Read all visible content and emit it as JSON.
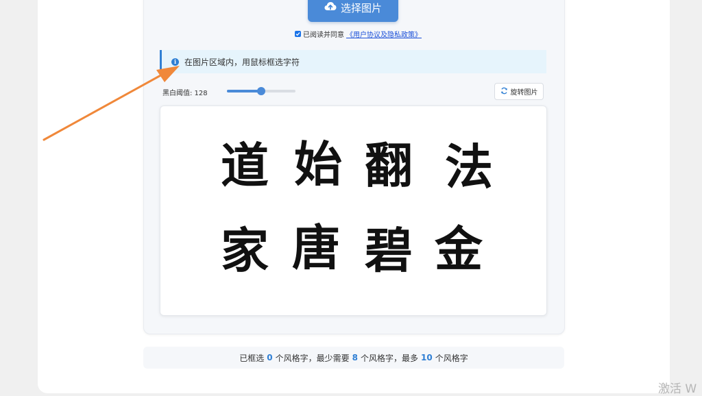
{
  "upload": {
    "choose_label": "选择图片",
    "agree_text": "已阅读并同意",
    "policy_link": "《用户协议及隐私政策》",
    "agree_checked": true
  },
  "info": {
    "message": "在图片区域内，用鼠标框选字符"
  },
  "controls": {
    "threshold_label": "黑白阈值: 128",
    "threshold_value": 128,
    "threshold_max": 255,
    "rotate_label": "旋转图片"
  },
  "image": {
    "characters": [
      "道",
      "始",
      "翻",
      "法",
      "家",
      "唐",
      "碧",
      "金"
    ]
  },
  "summary": {
    "selected_prefix": "已框选",
    "selected_count": "0",
    "selected_suffix": "个风格字，最少需要",
    "min_count": "8",
    "min_suffix": "个风格字，最多",
    "max_count": "10",
    "max_suffix": "个风格字"
  },
  "watermark": "激活 W",
  "colors": {
    "accent": "#4a8ad8",
    "arrow": "#f0883a",
    "info_bg": "#e6f4fc"
  }
}
